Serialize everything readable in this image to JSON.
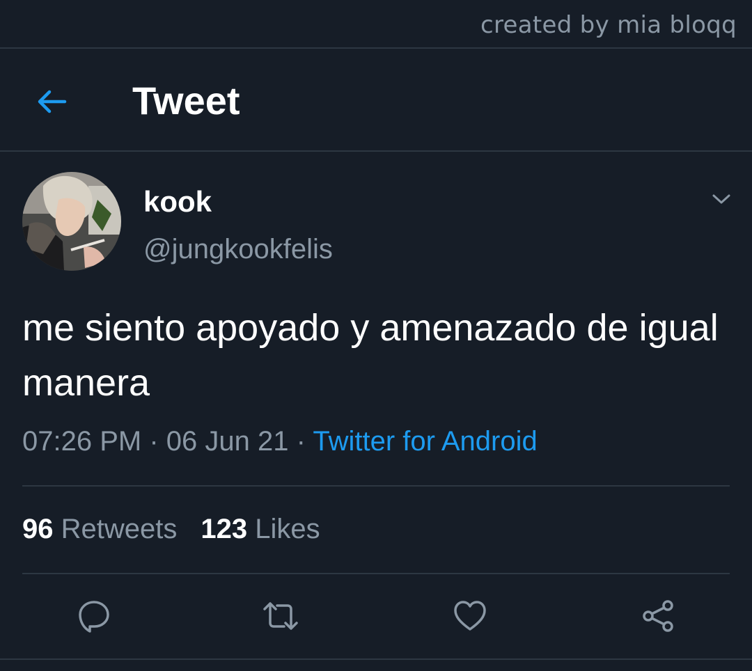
{
  "watermark": "created by mia bloqq",
  "header": {
    "back_icon": "arrow-left-icon",
    "title": "Tweet"
  },
  "tweet": {
    "display_name": "kook",
    "handle": "@jungkookfelis",
    "menu_icon": "chevron-down-icon",
    "text": "me siento apoyado y amenazado de igual manera",
    "time": "07:26 PM",
    "separator": "·",
    "date": "06 Jun 21",
    "source": "Twitter for Android",
    "retweets_count": "96",
    "retweets_label": "Retweets",
    "likes_count": "123",
    "likes_label": "Likes"
  },
  "actions": [
    {
      "name": "reply",
      "icon": "reply-icon"
    },
    {
      "name": "retweet",
      "icon": "retweet-icon"
    },
    {
      "name": "like",
      "icon": "heart-icon"
    },
    {
      "name": "share",
      "icon": "share-icon"
    }
  ],
  "colors": {
    "background": "#161d27",
    "accent": "#1d9bf0",
    "secondary_text": "#8b98a5",
    "divider": "#2d3742"
  }
}
